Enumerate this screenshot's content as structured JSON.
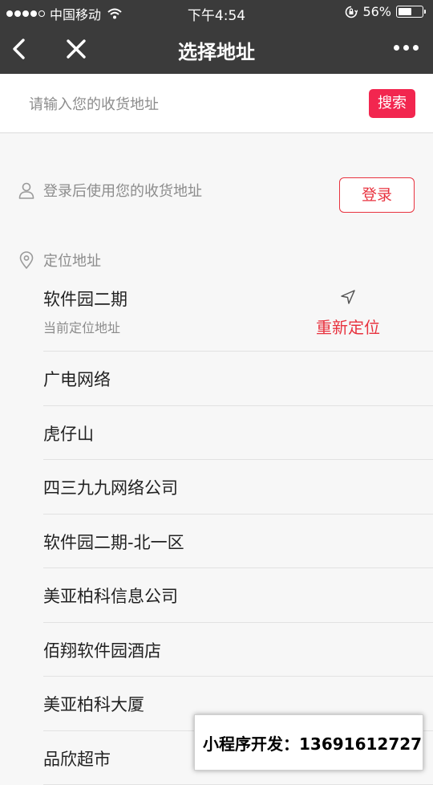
{
  "status_bar": {
    "carrier": "中国移动",
    "time": "下午4:54",
    "battery_percent": "56%",
    "battery_level": 0.56,
    "signal_bars": 4,
    "signal_total": 5
  },
  "nav": {
    "title": "选择地址",
    "back_icon": "chevron-left-icon",
    "close_icon": "close-icon",
    "more_icon": "more-dots-icon"
  },
  "search": {
    "placeholder": "请输入您的收货地址",
    "button_label": "搜索"
  },
  "login": {
    "hint": "登录后使用您的收货地址",
    "button_label": "登录"
  },
  "location": {
    "section_title": "定位地址",
    "current_name": "软件园二期",
    "current_sub": "当前定位地址",
    "relocate_label": "重新定位"
  },
  "addresses": [
    "广电网络",
    "虎仔山",
    "四三九九网络公司",
    "软件园二期-北一区",
    "美亚柏科信息公司",
    "佰翔软件园酒店",
    "美亚柏科大厦",
    "品欣超市"
  ],
  "watermark": {
    "text": "小程序开发：13691612727"
  },
  "colors": {
    "accent": "#f2264f",
    "accent_outline": "#e8333f",
    "bar_bg": "#3b3b3b",
    "page_bg": "#f7f7f7"
  }
}
